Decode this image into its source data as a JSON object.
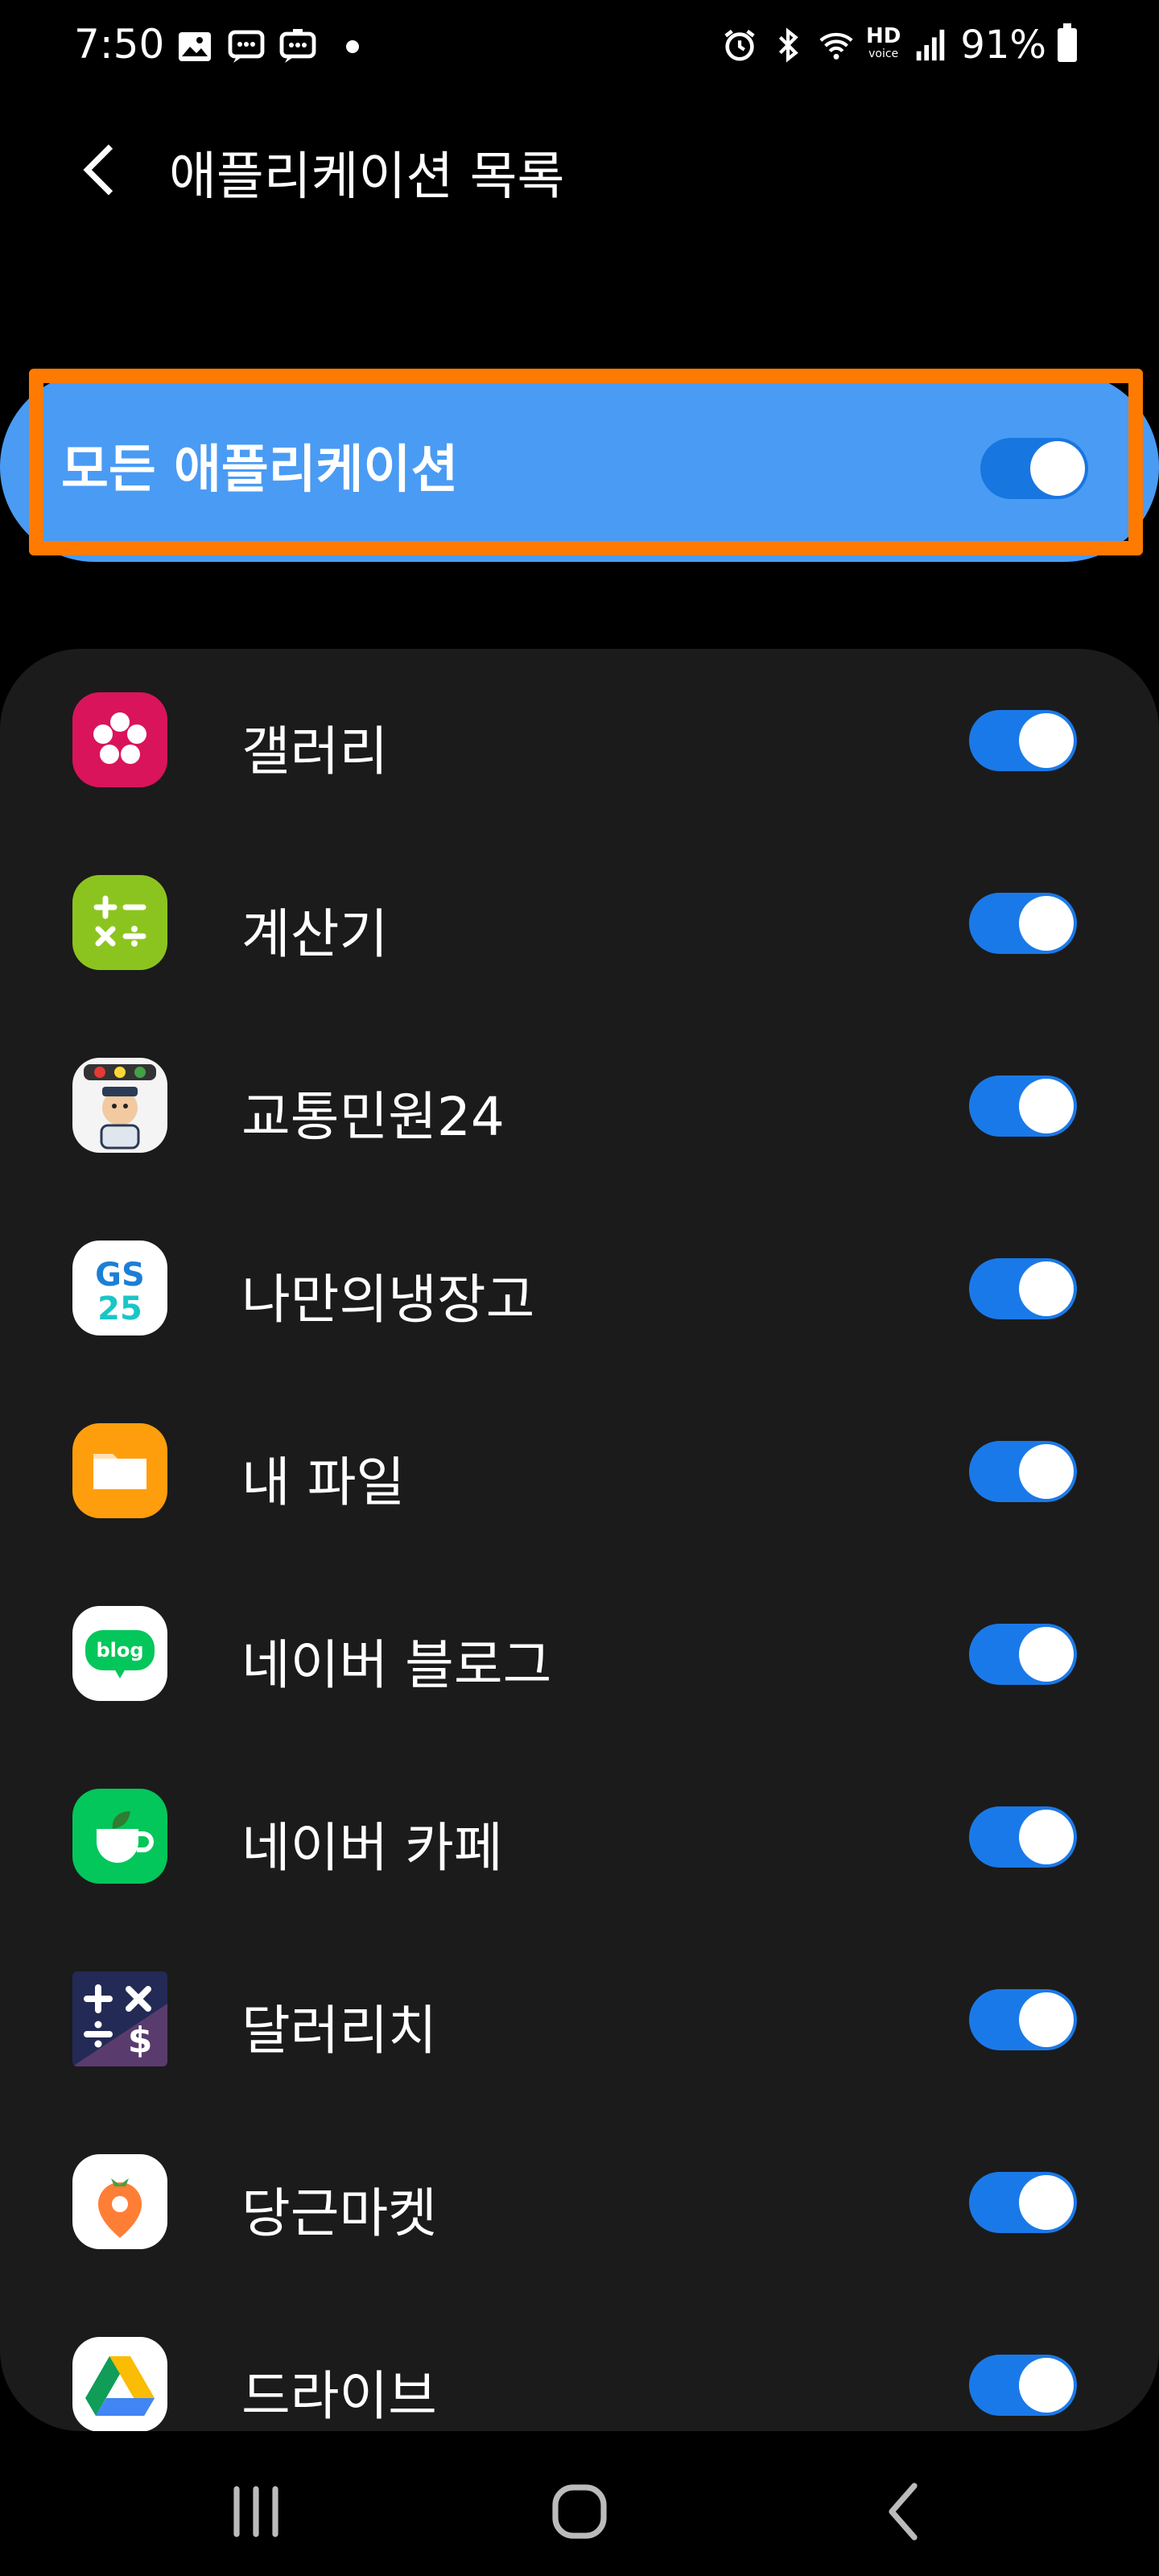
{
  "status_bar": {
    "time": "7:50",
    "battery_percent": "91%",
    "hd_label": "HD",
    "hd_sub": "voice"
  },
  "header": {
    "title": "애플리케이션 목록"
  },
  "all_apps": {
    "label": "모든 애플리케이션",
    "enabled": true
  },
  "apps": [
    {
      "name": "갤러리",
      "icon": "gallery-icon",
      "enabled": true
    },
    {
      "name": "계산기",
      "icon": "calculator-icon",
      "enabled": true
    },
    {
      "name": "교통민원24",
      "icon": "traffic-complaint-icon",
      "enabled": true
    },
    {
      "name": "나만의냉장고",
      "icon": "gs25-icon",
      "enabled": true
    },
    {
      "name": "내 파일",
      "icon": "my-files-icon",
      "enabled": true
    },
    {
      "name": "네이버 블로그",
      "icon": "naver-blog-icon",
      "enabled": true
    },
    {
      "name": "네이버 카페",
      "icon": "naver-cafe-icon",
      "enabled": true
    },
    {
      "name": "달러리치",
      "icon": "dollar-rich-icon",
      "enabled": true
    },
    {
      "name": "당근마켓",
      "icon": "carrot-market-icon",
      "enabled": true
    },
    {
      "name": "드라이브",
      "icon": "google-drive-icon",
      "enabled": true
    }
  ],
  "icon_text": {
    "gs_top": "GS",
    "gs_bottom": "25",
    "blog": "blog"
  },
  "colors": {
    "accent": "#4a9bf4",
    "toggle_on": "#1a79e8",
    "highlight": "#ff7a00",
    "card_bg": "#1b1b1b"
  }
}
